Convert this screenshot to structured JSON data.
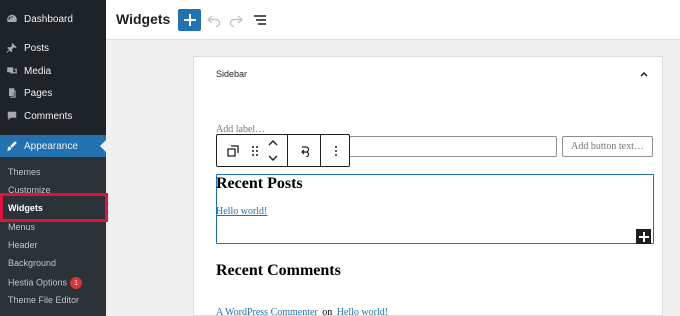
{
  "sidebar": {
    "items": [
      {
        "label": "Dashboard",
        "icon": "dashboard-icon"
      },
      {
        "label": "Posts",
        "icon": "pin-icon"
      },
      {
        "label": "Media",
        "icon": "media-icon"
      },
      {
        "label": "Pages",
        "icon": "pages-icon"
      },
      {
        "label": "Comments",
        "icon": "comments-icon"
      },
      {
        "label": "Appearance",
        "icon": "paintbrush-icon"
      }
    ],
    "submenu": [
      {
        "label": "Themes"
      },
      {
        "label": "Customize"
      },
      {
        "label": "Widgets"
      },
      {
        "label": "Menus"
      },
      {
        "label": "Header"
      },
      {
        "label": "Background"
      },
      {
        "label": "Hestia Options",
        "badge": "1"
      },
      {
        "label": "Theme File Editor"
      }
    ]
  },
  "header": {
    "title": "Widgets"
  },
  "editor": {
    "area_title": "Sidebar",
    "label_placeholder": "Add label…",
    "button_placeholder": "Add button text…",
    "blocks": {
      "recent_posts_heading": "Recent Posts",
      "recent_posts_link": "Hello world!",
      "recent_comments_heading": "Recent Comments",
      "comment_author": "A WordPress Commenter",
      "comment_on": "on",
      "comment_post": "Hello world!"
    }
  },
  "colors": {
    "accent": "#2271b1",
    "sidebar_bg": "#1d2327",
    "highlight": "#e0123a",
    "badge": "#d63638"
  }
}
